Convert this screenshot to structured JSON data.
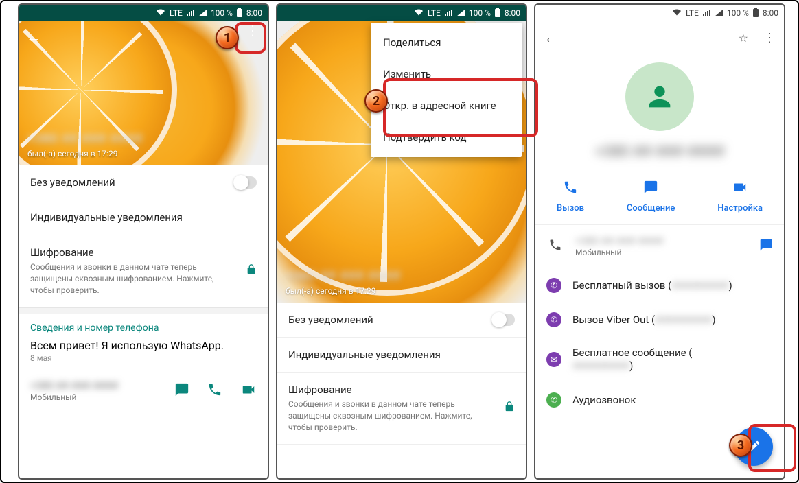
{
  "statusbar": {
    "network": "LTE",
    "battery_pct": "100 %",
    "time": "8:00"
  },
  "screen1": {
    "last_seen": "был(-а) сегодня в 17:29",
    "mute_label": "Без уведомлений",
    "custom_notif": "Индивидуальные уведомления",
    "encryption_title": "Шифрование",
    "encryption_desc": "Сообщения и звонки в данном чате теперь защищены сквозным шифрованием. Нажмите, чтобы проверить.",
    "info_header": "Сведения и номер телефона",
    "about_text": "Всем привет! Я использую WhatsApp.",
    "about_date": "8 мая",
    "phone_type": "Мобильный"
  },
  "screen2": {
    "menu": {
      "share": "Поделиться",
      "edit": "Изменить",
      "open_addr": "Откр. в адресной книге",
      "verify": "Подтвердить код"
    },
    "last_seen": "был(-а) сегодня в 17:29",
    "mute_label": "Без уведомлений",
    "custom_notif": "Индивидуальные уведомления",
    "encryption_title": "Шифрование",
    "encryption_desc": "Сообщения и звонки в данном чате теперь защищены сквозным шифрованием. Нажмите, чтобы проверить."
  },
  "screen3": {
    "actions": {
      "call": "Вызов",
      "message": "Сообщение",
      "video": "Настройка"
    },
    "mobile_label": "Мобильный",
    "viber_free_call": "Бесплатный вызов (",
    "viber_out": "Вызов Viber Out (",
    "viber_free_msg": "Бесплатное сообщение (",
    "audio_call": "Аудиозвонок",
    "paren_close": ")"
  },
  "steps": {
    "s1": "1",
    "s2": "2",
    "s3": "3"
  }
}
